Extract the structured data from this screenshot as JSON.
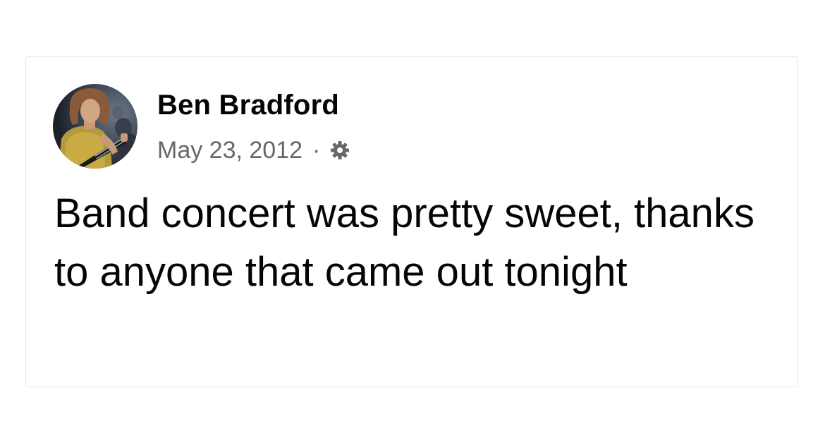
{
  "post": {
    "author": {
      "name": "Ben Bradford",
      "avatar_alt": "profile photo"
    },
    "date": "May 23, 2012",
    "separator": "·",
    "audience_icon": "gear-icon",
    "text": "Band concert was pretty sweet, thanks to anyone that came out tonight"
  },
  "colors": {
    "text_primary": "#050505",
    "text_secondary": "#65676b",
    "card_border": "#e4e6eb",
    "background": "#ffffff"
  }
}
